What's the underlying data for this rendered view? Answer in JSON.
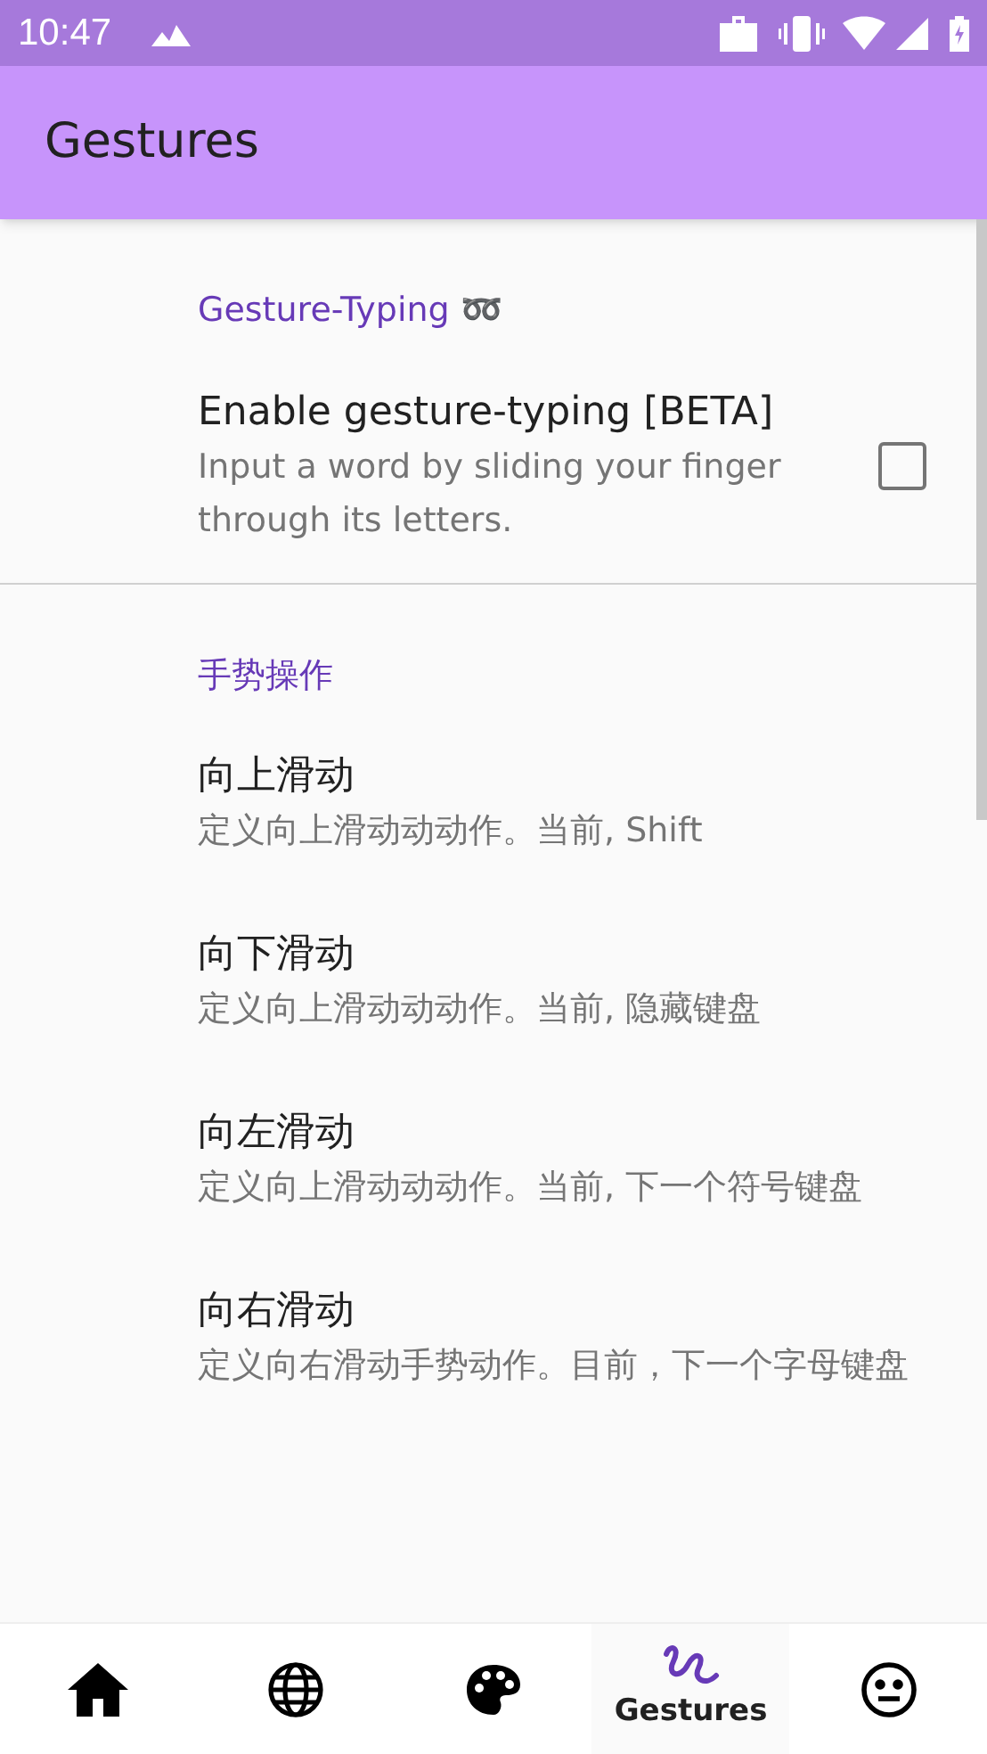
{
  "status_bar": {
    "time": "10:47"
  },
  "app_bar": {
    "title": "Gestures"
  },
  "sections": [
    {
      "title": "Gesture-Typing ➿",
      "items": [
        {
          "kind": "checkbox",
          "title": "Enable gesture-typing [BETA]",
          "summary": "Input a word by sliding your finger through its letters.",
          "checked": false
        }
      ]
    },
    {
      "title": "手势操作",
      "items": [
        {
          "kind": "plain",
          "title": "向上滑动",
          "summary": "定义向上滑动动动作。当前, Shift"
        },
        {
          "kind": "plain",
          "title": "向下滑动",
          "summary": "定义向上滑动动动作。当前, 隐藏键盘"
        },
        {
          "kind": "plain",
          "title": "向左滑动",
          "summary": "定义向上滑动动动作。当前, 下一个符号键盘"
        },
        {
          "kind": "plain",
          "title": "向右滑动",
          "summary": "定义向右滑动手势动作。目前，下一个字母键盘"
        }
      ]
    }
  ],
  "bottom_nav": [
    {
      "kind": "home",
      "selected": false
    },
    {
      "kind": "globe",
      "selected": false
    },
    {
      "kind": "palette",
      "selected": false
    },
    {
      "kind": "gesture",
      "label": "Gestures",
      "selected": true
    },
    {
      "kind": "face",
      "selected": false
    }
  ]
}
